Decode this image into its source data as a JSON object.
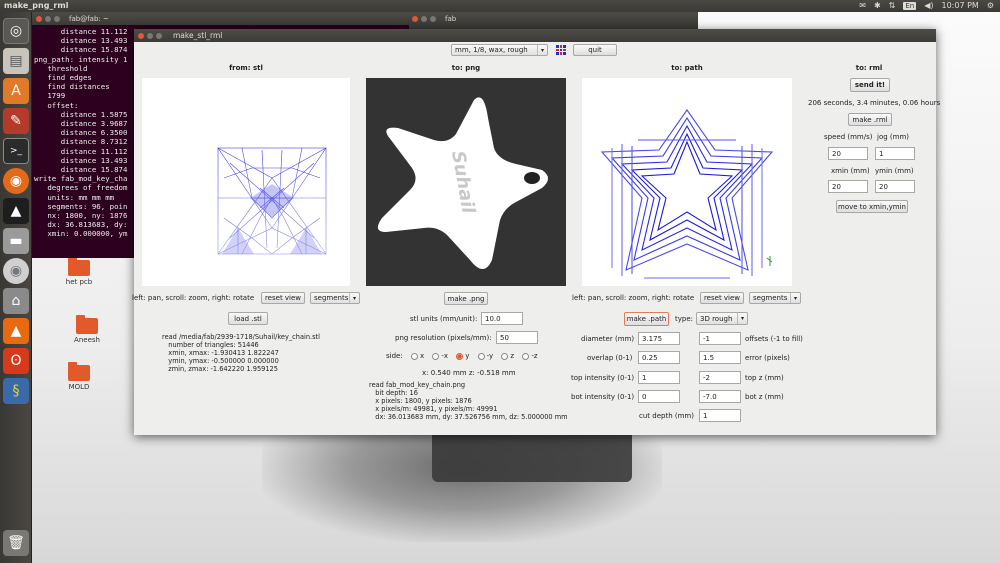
{
  "top_panel": {
    "title": "make_png_rml",
    "lang": "En",
    "time": "10:07 PM"
  },
  "launcher": {
    "items": [
      "ubuntu-icon",
      "files-icon",
      "software-center-icon",
      "settings-icon",
      "terminal-icon",
      "firefox-icon",
      "inkscape-icon",
      "drive-icon",
      "disc-icon",
      "usb-icon",
      "vlc-icon",
      "ubuntu-one-icon",
      "python-icon",
      "trash-icon"
    ]
  },
  "desktop_icons": [
    {
      "label": "het pcb"
    },
    {
      "label": "Aneesh"
    },
    {
      "label": "MOLD"
    }
  ],
  "terminal": {
    "title": "fab@fab: ~",
    "lines": [
      "      distance 11.112",
      "      distance 13.493",
      "      distance 15.874",
      "png_path: intensity 1",
      "   threshold",
      "   find edges",
      "   find distances",
      "   1799",
      "   offset:",
      "      distance 1.5875",
      "      distance 3.9687",
      "      distance 6.3500",
      "      distance 8.7312",
      "      distance 11.112",
      "      distance 13.493",
      "      distance 15.874",
      "write fab_mod_key_cha",
      "   degrees of freedom",
      "   units: mm mm mm",
      "   segments: 96, poin",
      "   nx: 1800, ny: 1876",
      "   dx: 36.813683, dy:",
      "   xmin: 0.000000, ym"
    ]
  },
  "bg_window": {
    "title": "fab"
  },
  "main": {
    "title": "make_stl_rml",
    "material_select": "mm, 1/8, wax, rough",
    "quit": "quit",
    "stl": {
      "title": "from: stl",
      "hint": "left: pan, scroll: zoom, right: rotate",
      "reset_view": "reset view",
      "segments": "segments",
      "load": "load .stl",
      "info": "read /media/fab/2939-1718/Suhail/key_chain.stl\n   number of triangles: 51446\n   xmin, xmax: -1.930413 1.822247\n   ymin, ymax: -0.500000 0.000000\n   zmin, zmax: -1.642220 1.959125"
    },
    "png": {
      "title": "to: png",
      "text_on_star": "Suhail",
      "make_png": "make .png",
      "stl_units_label": "stl units (mm/unit):",
      "stl_units_value": "10.0",
      "png_res_label": "png resolution (pixels/mm):",
      "png_res_value": "50",
      "side_label": "side:",
      "sides": [
        "x",
        "-x",
        "y",
        "-y",
        "z",
        "-z"
      ],
      "side_selected": "y",
      "xz_readout": "x: 0.540 mm  z: -0.518 mm",
      "info": "read fab_mod_key_chain.png\n   bit depth: 16\n   x pixels: 1800, y pixels: 1876\n   x pixels/m: 49981, y pixels/m: 49991\n   dx: 36.013683 mm, dy: 37.526756 mm, dz: 5.000000 mm"
    },
    "path": {
      "title": "to: path",
      "hint": "left: pan, scroll: zoom, right: rotate",
      "reset_view": "reset view",
      "segments": "segments",
      "make_path": "make .path",
      "type_label": "type:",
      "type_value": "3D rough",
      "diameter_label": "diameter (mm)",
      "diameter_value": "3.175",
      "offsets_value": "-1",
      "offsets_label": "offsets (-1 to fill)",
      "overlap_label": "overlap (0-1)",
      "overlap_value": "0.25",
      "error_value": "1.5",
      "error_label": "error (pixels)",
      "top_int_label": "top intensity (0-1)",
      "top_int_value": "1",
      "top_z_value": "-2",
      "top_z_label": "top z (mm)",
      "bot_int_label": "bot intensity (0-1)",
      "bot_int_value": "0",
      "bot_z_value": "-7.0",
      "bot_z_label": "bot z (mm)",
      "cut_depth_label": "cut depth (mm)",
      "cut_depth_value": "1"
    },
    "rml": {
      "title": "to: rml",
      "send": "send it!",
      "time_estimate": "206 seconds, 3.4 minutes, 0.06 hours",
      "make_rml": "make .rml",
      "speed_label": "speed (mm/s)",
      "jog_label": "jog (mm)",
      "speed_value": "20",
      "jog_value": "1",
      "xmin_label": "xmin (mm)",
      "ymin_label": "ymin (mm)",
      "xmin_value": "20",
      "ymin_value": "20",
      "move": "move to xmin,ymin"
    }
  }
}
